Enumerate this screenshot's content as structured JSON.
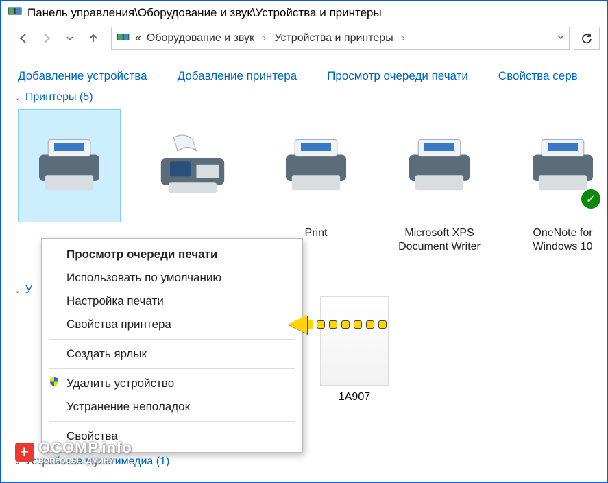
{
  "title": "Панель управления\\Оборудование и звук\\Устройства и принтеры",
  "breadcrumb": {
    "item1": "Оборудование и звук",
    "item2": "Устройства и принтеры",
    "chevron_name": "breadcrumb-chevron"
  },
  "toolbar": {
    "add_device": "Добавление устройства",
    "add_printer": "Добавление принтера",
    "view_queue": "Просмотр очереди печати",
    "server_props": "Свойства серв"
  },
  "group_printers": {
    "label": "Принтеры (5)"
  },
  "devices": [
    {
      "name": "",
      "icon": "printer",
      "selected": true,
      "default": false
    },
    {
      "name": "",
      "icon": "fax",
      "selected": false,
      "default": false
    },
    {
      "name": "Print",
      "icon": "printer",
      "selected": false,
      "default": false
    },
    {
      "name": "Microsoft XPS Document Writer",
      "icon": "printer",
      "selected": false,
      "default": false
    },
    {
      "name": "OneNote for Windows 10",
      "icon": "printer",
      "selected": false,
      "default": true
    }
  ],
  "context_menu": {
    "view_queue": "Просмотр очереди печати",
    "set_default": "Использовать по умолчанию",
    "print_prefs": "Настройка печати",
    "printer_props": "Свойства принтера",
    "create_shortcut": "Создать ярлык",
    "remove_device": "Удалить устройство",
    "troubleshoot": "Устранение неполадок",
    "properties": "Свойства"
  },
  "group_devices": {
    "label_partial": "У"
  },
  "hidden_device_label": "1A907",
  "group_multimedia": {
    "label": "Устройства мультимедиа (1)"
  },
  "watermark": {
    "text": "OCOMP.info",
    "sub": "ВОПРОСЫ АДМИНУ"
  }
}
